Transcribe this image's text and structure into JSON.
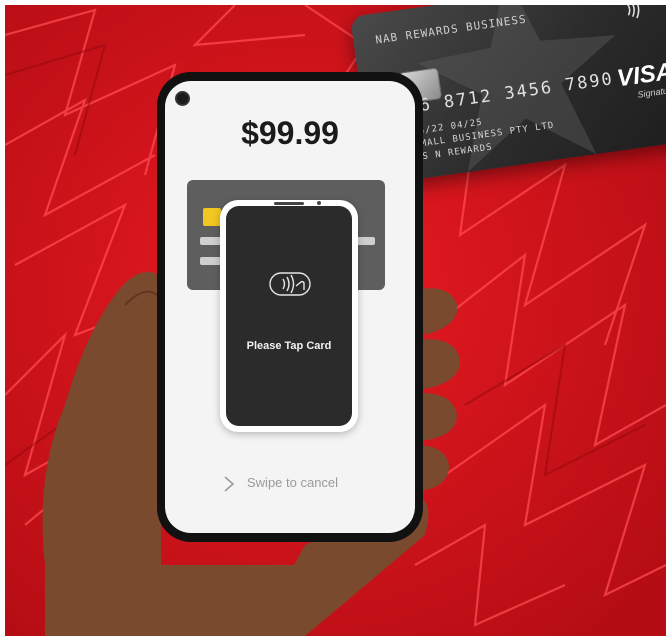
{
  "payment": {
    "amount": "$99.99",
    "prompt": "Please Tap Card",
    "swipe_cancel": "Swipe to cancel"
  },
  "card": {
    "issuer": "NAB REWARDS BUSINESS",
    "number": "4336 8712 3456 7890",
    "valid_dates": "04/22        04/25",
    "company": "SMALL BUSINESS PTY LTD",
    "holder": "MS N REWARDS",
    "brand": "VISA",
    "brand_sub": "Signature"
  },
  "icons": {
    "contactless": "contactless-tap-icon",
    "chevron": "chevron-right-icon",
    "card_contactless": "contactless-icon"
  },
  "colors": {
    "background": "#d8141c",
    "phone_body": "#111111",
    "screen": "#f4f4f4",
    "chip_accent": "#f2c623"
  }
}
